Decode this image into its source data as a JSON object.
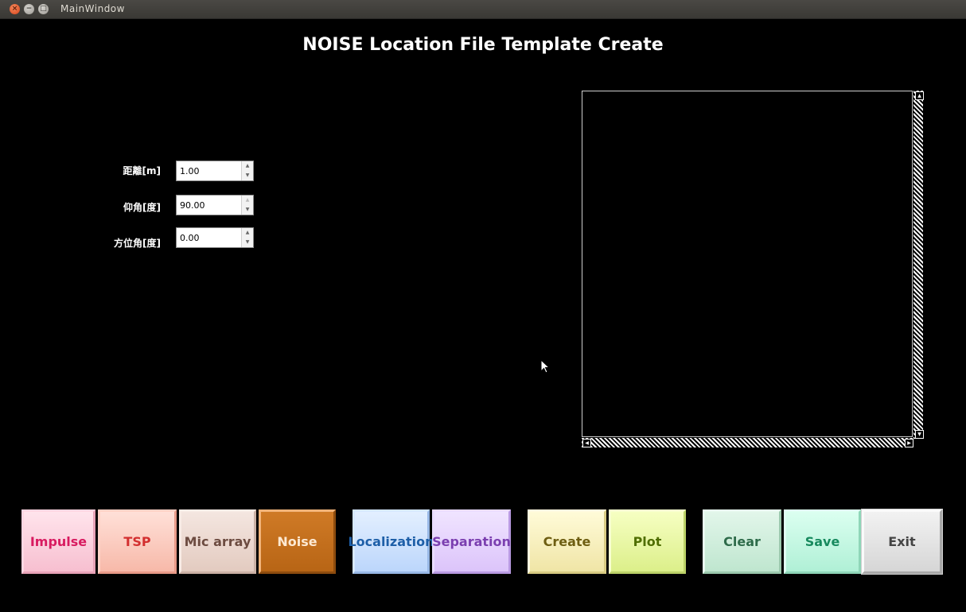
{
  "window": {
    "title": "MainWindow",
    "close_glyph": "×",
    "min_glyph": "−",
    "max_glyph": "□"
  },
  "app": {
    "title": "NOISE Location File Template Create"
  },
  "form": {
    "distance": {
      "label": "距離[m]",
      "value": "1.00"
    },
    "elevation": {
      "label": "仰角[度]",
      "value": "90.00"
    },
    "azimuth": {
      "label": "方位角[度]",
      "value": "0.00"
    }
  },
  "buttons": {
    "impulse": "Impulse",
    "tsp": "TSP",
    "mic_array": "Mic array",
    "noise": "Noise",
    "localization": "Localization",
    "separation": "Separation",
    "create": "Create",
    "plot": "Plot",
    "clear": "Clear",
    "save": "Save",
    "exit": "Exit"
  },
  "colors": {
    "impulse": "#d81b60",
    "tsp": "#d32f2f",
    "mic_array": "#6d4c41",
    "noise": "#c46f1e",
    "localization": "#1e5fa8",
    "separation": "#7b3fb0",
    "create": "#7a6a1a",
    "plot": "#5a7a00",
    "clear": "#2e6b4a",
    "save": "#178a5e",
    "exit": "#444444"
  }
}
